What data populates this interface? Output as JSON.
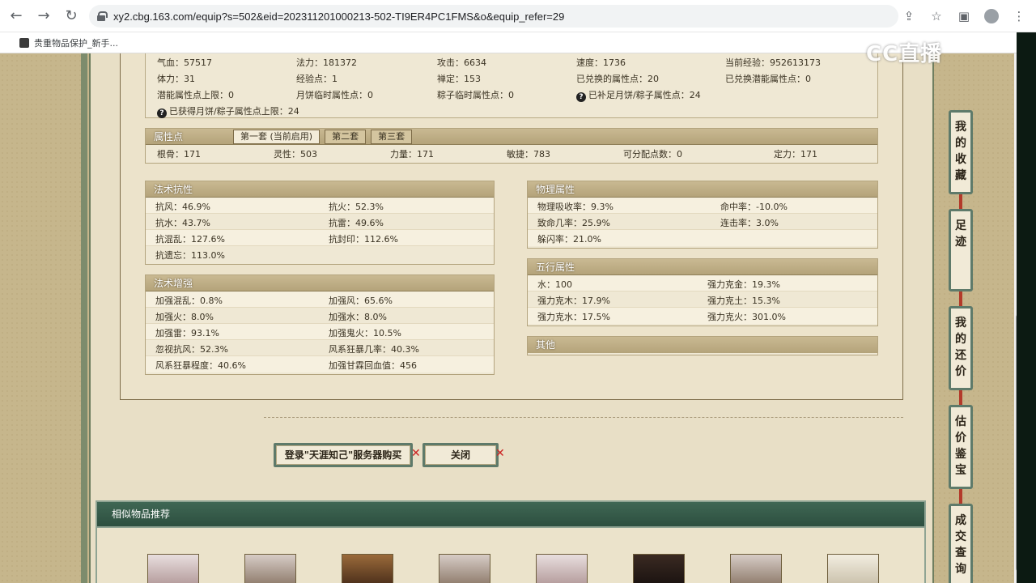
{
  "browser": {
    "url": "xy2.cbg.163.com/equip?s=502&eid=202311201000213-502-TI9ER4PC1FMS&o&equip_refer=29",
    "bookmark_label": "贵重物品保护_新手..."
  },
  "watermark": "CC直播",
  "basic_stats": {
    "row1": [
      "气血：57517",
      "法力：181372",
      "攻击：6634",
      "速度：1736",
      "当前经验：952613173"
    ],
    "row2": [
      "体力：31",
      "经验点：1",
      "禅定：153",
      "已兑换的属性点：20",
      "已兑换潜能属性点：0"
    ],
    "row3": [
      "潜能属性点上限：0",
      "月饼临时属性点：0",
      "粽子临时属性点：0",
      "已补足月饼/粽子属性点：24"
    ],
    "row4": "已获得月饼/粽子属性点上限：24"
  },
  "attr_points": {
    "title": "属性点",
    "tabs": [
      "第一套 (当前启用)",
      "第二套",
      "第三套"
    ],
    "values": [
      "根骨：171",
      "灵性：503",
      "力量：171",
      "敏捷：783",
      "可分配点数：0",
      "定力：171"
    ]
  },
  "resist": {
    "title": "法术抗性",
    "rows": [
      [
        "抗风：46.9%",
        "抗火：52.3%"
      ],
      [
        "抗水：43.7%",
        "抗雷：49.6%"
      ],
      [
        "抗混乱：127.6%",
        "抗封印：112.6%"
      ],
      [
        "抗遗忘：113.0%",
        ""
      ]
    ]
  },
  "enhance": {
    "title": "法术增强",
    "rows": [
      [
        "加强混乱：0.8%",
        "加强风：65.6%"
      ],
      [
        "加强火：8.0%",
        "加强水：8.0%"
      ],
      [
        "加强雷：93.1%",
        "加强鬼火：10.5%"
      ],
      [
        "忽视抗风：52.3%",
        "风系狂暴几率：40.3%"
      ],
      [
        "风系狂暴程度：40.6%",
        "加强甘霖回血值：456"
      ]
    ]
  },
  "physical": {
    "title": "物理属性",
    "rows": [
      [
        "物理吸收率：9.3%",
        "命中率：-10.0%"
      ],
      [
        "致命几率：25.9%",
        "连击率：3.0%"
      ],
      [
        "躲闪率：21.0%",
        ""
      ]
    ]
  },
  "five_elements": {
    "title": "五行属性",
    "rows": [
      [
        "水：100",
        "强力克金：19.3%"
      ],
      [
        "强力克木：17.9%",
        "强力克土：15.3%"
      ],
      [
        "强力克水：17.5%",
        "强力克火：301.0%"
      ]
    ]
  },
  "other": {
    "title": "其他"
  },
  "buttons": {
    "login_buy": "登录\"天涯知己\"服务器购买",
    "close": "关闭"
  },
  "similar": {
    "title": "相似物品推荐"
  },
  "sidebar": {
    "items": [
      "我的收藏",
      "足迹",
      "我的还价",
      "估价鉴宝",
      "成交查询"
    ]
  }
}
